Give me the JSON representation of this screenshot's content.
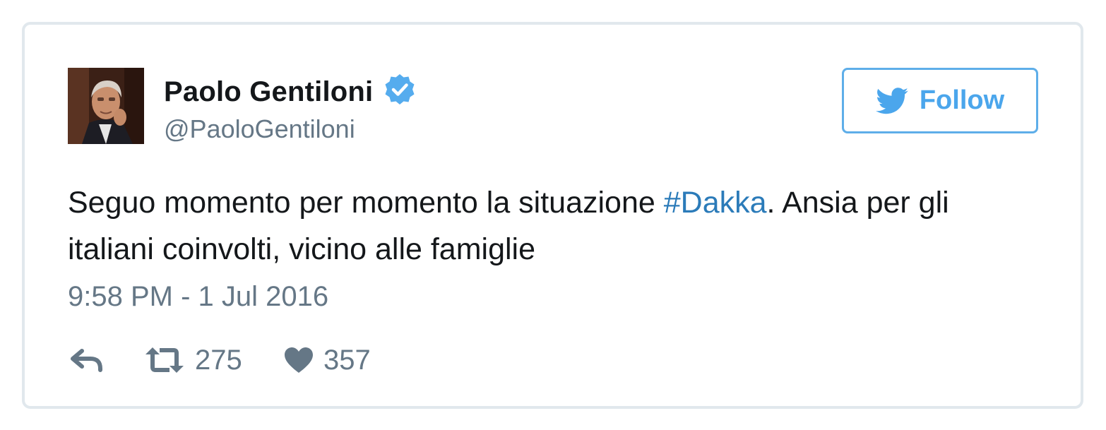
{
  "user": {
    "name": "Paolo Gentiloni",
    "handle": "@PaoloGentiloni",
    "verified": true,
    "avatar": "profile-photo"
  },
  "follow_button": {
    "label": "Follow",
    "icon": "twitter-bird-icon"
  },
  "tweet": {
    "text_before": "Seguo momento per momento la situazione ",
    "hashtag": "#Dakka",
    "text_after": ". Ansia per gli italiani coinvolti, vicino alle famiglie",
    "timestamp": "9:58 PM - 1 Jul 2016"
  },
  "actions": {
    "reply_icon": "reply-icon",
    "retweet_icon": "retweet-icon",
    "retweet_count": "275",
    "like_icon": "heart-icon",
    "like_count": "357"
  },
  "colors": {
    "link": "#2b7bb9",
    "follow_accent": "#4ba6ec",
    "verified": "#55acee",
    "muted": "#657786",
    "border": "#e1e8ed"
  }
}
